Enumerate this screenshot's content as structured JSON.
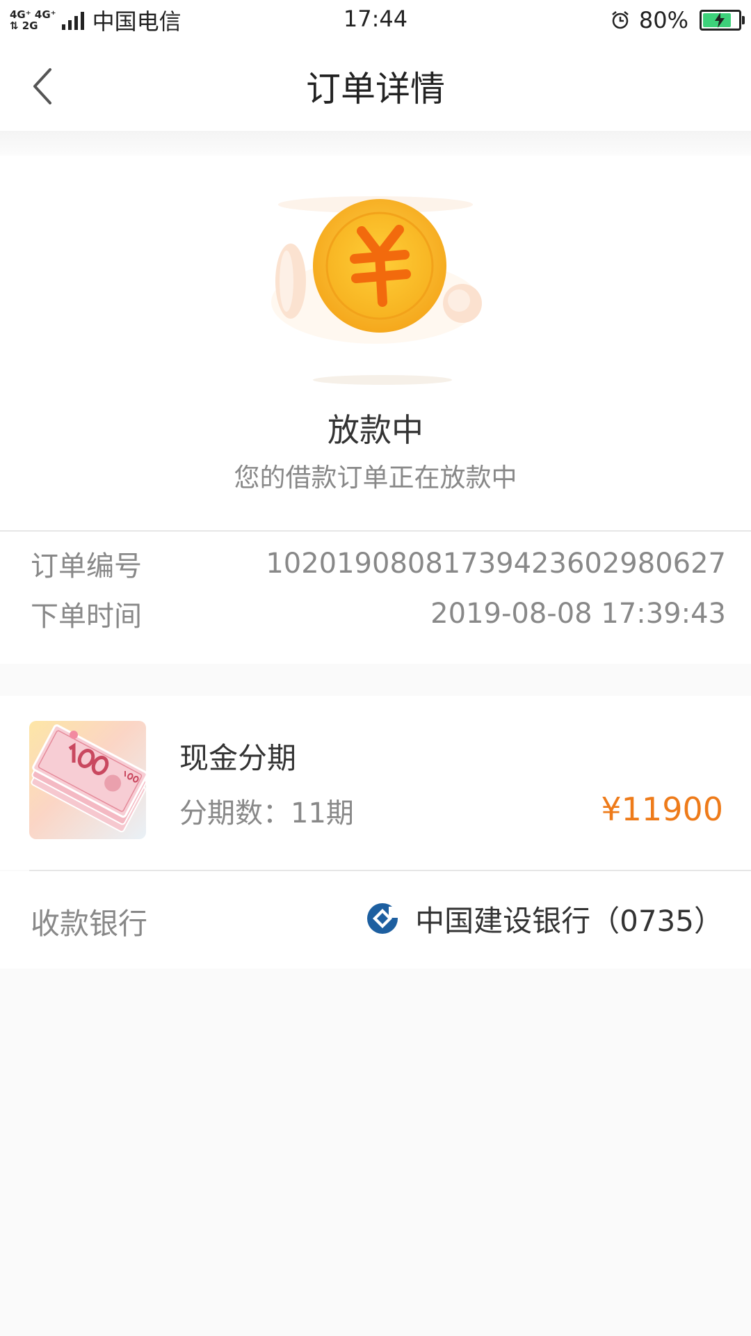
{
  "status_bar": {
    "network_top": "4G⁺ 4G⁺",
    "network_bottom": "⇅ 2G",
    "carrier": "中国电信",
    "time": "17:44",
    "battery_percent": "80%",
    "battery_level": 0.8
  },
  "nav": {
    "title": "订单详情"
  },
  "hero": {
    "status_title": "放款中",
    "status_subtitle": "您的借款订单正在放款中"
  },
  "order": {
    "number_label": "订单编号",
    "number_value": "10201908081739423602980627",
    "time_label": "下单时间",
    "time_value": "2019-08-08 17:39:43"
  },
  "product": {
    "name": "现金分期",
    "periods": "分期数：11期",
    "price": "¥11900"
  },
  "bank": {
    "label": "收款银行",
    "name": "中国建设银行（0735）"
  },
  "colors": {
    "accent": "#ee7b1a",
    "coin": "#f9c22e",
    "battery": "#3dd17a"
  }
}
